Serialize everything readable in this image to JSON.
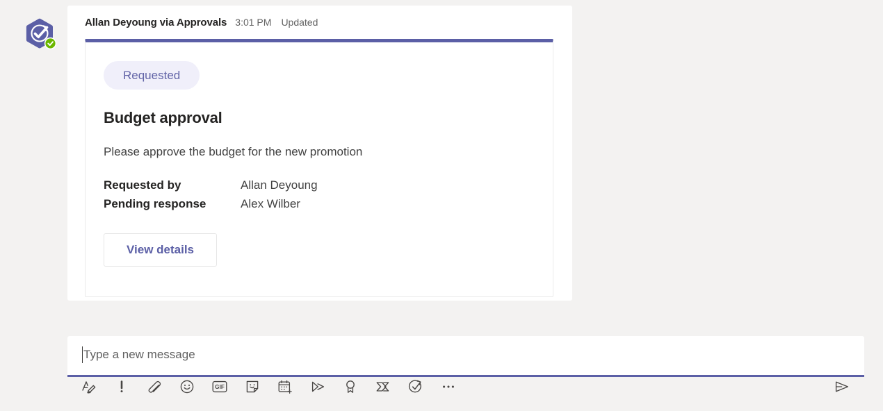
{
  "message": {
    "author": "Allan Deyoung via Approvals",
    "time": "3:01 PM",
    "status": "Updated",
    "avatar_icon": "approvals-app-avatar",
    "presence_icon": "available-badge"
  },
  "card": {
    "accent_color": "#5b5fa6",
    "badge": {
      "label": "Requested",
      "bg_color": "#f0effa",
      "text_color": "#6264a7"
    },
    "title": "Budget approval",
    "description": "Please approve the budget for the new promotion",
    "facts": [
      {
        "name": "Requested by",
        "value": "Allan Deyoung"
      },
      {
        "name": "Pending response",
        "value": "Alex Wilber"
      }
    ],
    "actions": [
      {
        "label": "View details",
        "name": "view-details-button"
      }
    ]
  },
  "compose": {
    "placeholder": "Type a new message",
    "value": "",
    "toolbar": [
      {
        "name": "format-icon",
        "label": "Format"
      },
      {
        "name": "importance-icon",
        "label": "Set delivery options"
      },
      {
        "name": "attach-icon",
        "label": "Attach"
      },
      {
        "name": "emoji-icon",
        "label": "Emoji"
      },
      {
        "name": "gif-icon",
        "label": "Giphy"
      },
      {
        "name": "sticker-icon",
        "label": "Sticker"
      },
      {
        "name": "schedule-meeting-icon",
        "label": "Schedule a meeting"
      },
      {
        "name": "stream-icon",
        "label": "Stream"
      },
      {
        "name": "praise-icon",
        "label": "Praise"
      },
      {
        "name": "power-automate-icon",
        "label": "Power Automate"
      },
      {
        "name": "approvals-icon",
        "label": "Approvals"
      },
      {
        "name": "more-options-icon",
        "label": "More options"
      }
    ],
    "send": {
      "name": "send-icon",
      "label": "Send"
    }
  }
}
